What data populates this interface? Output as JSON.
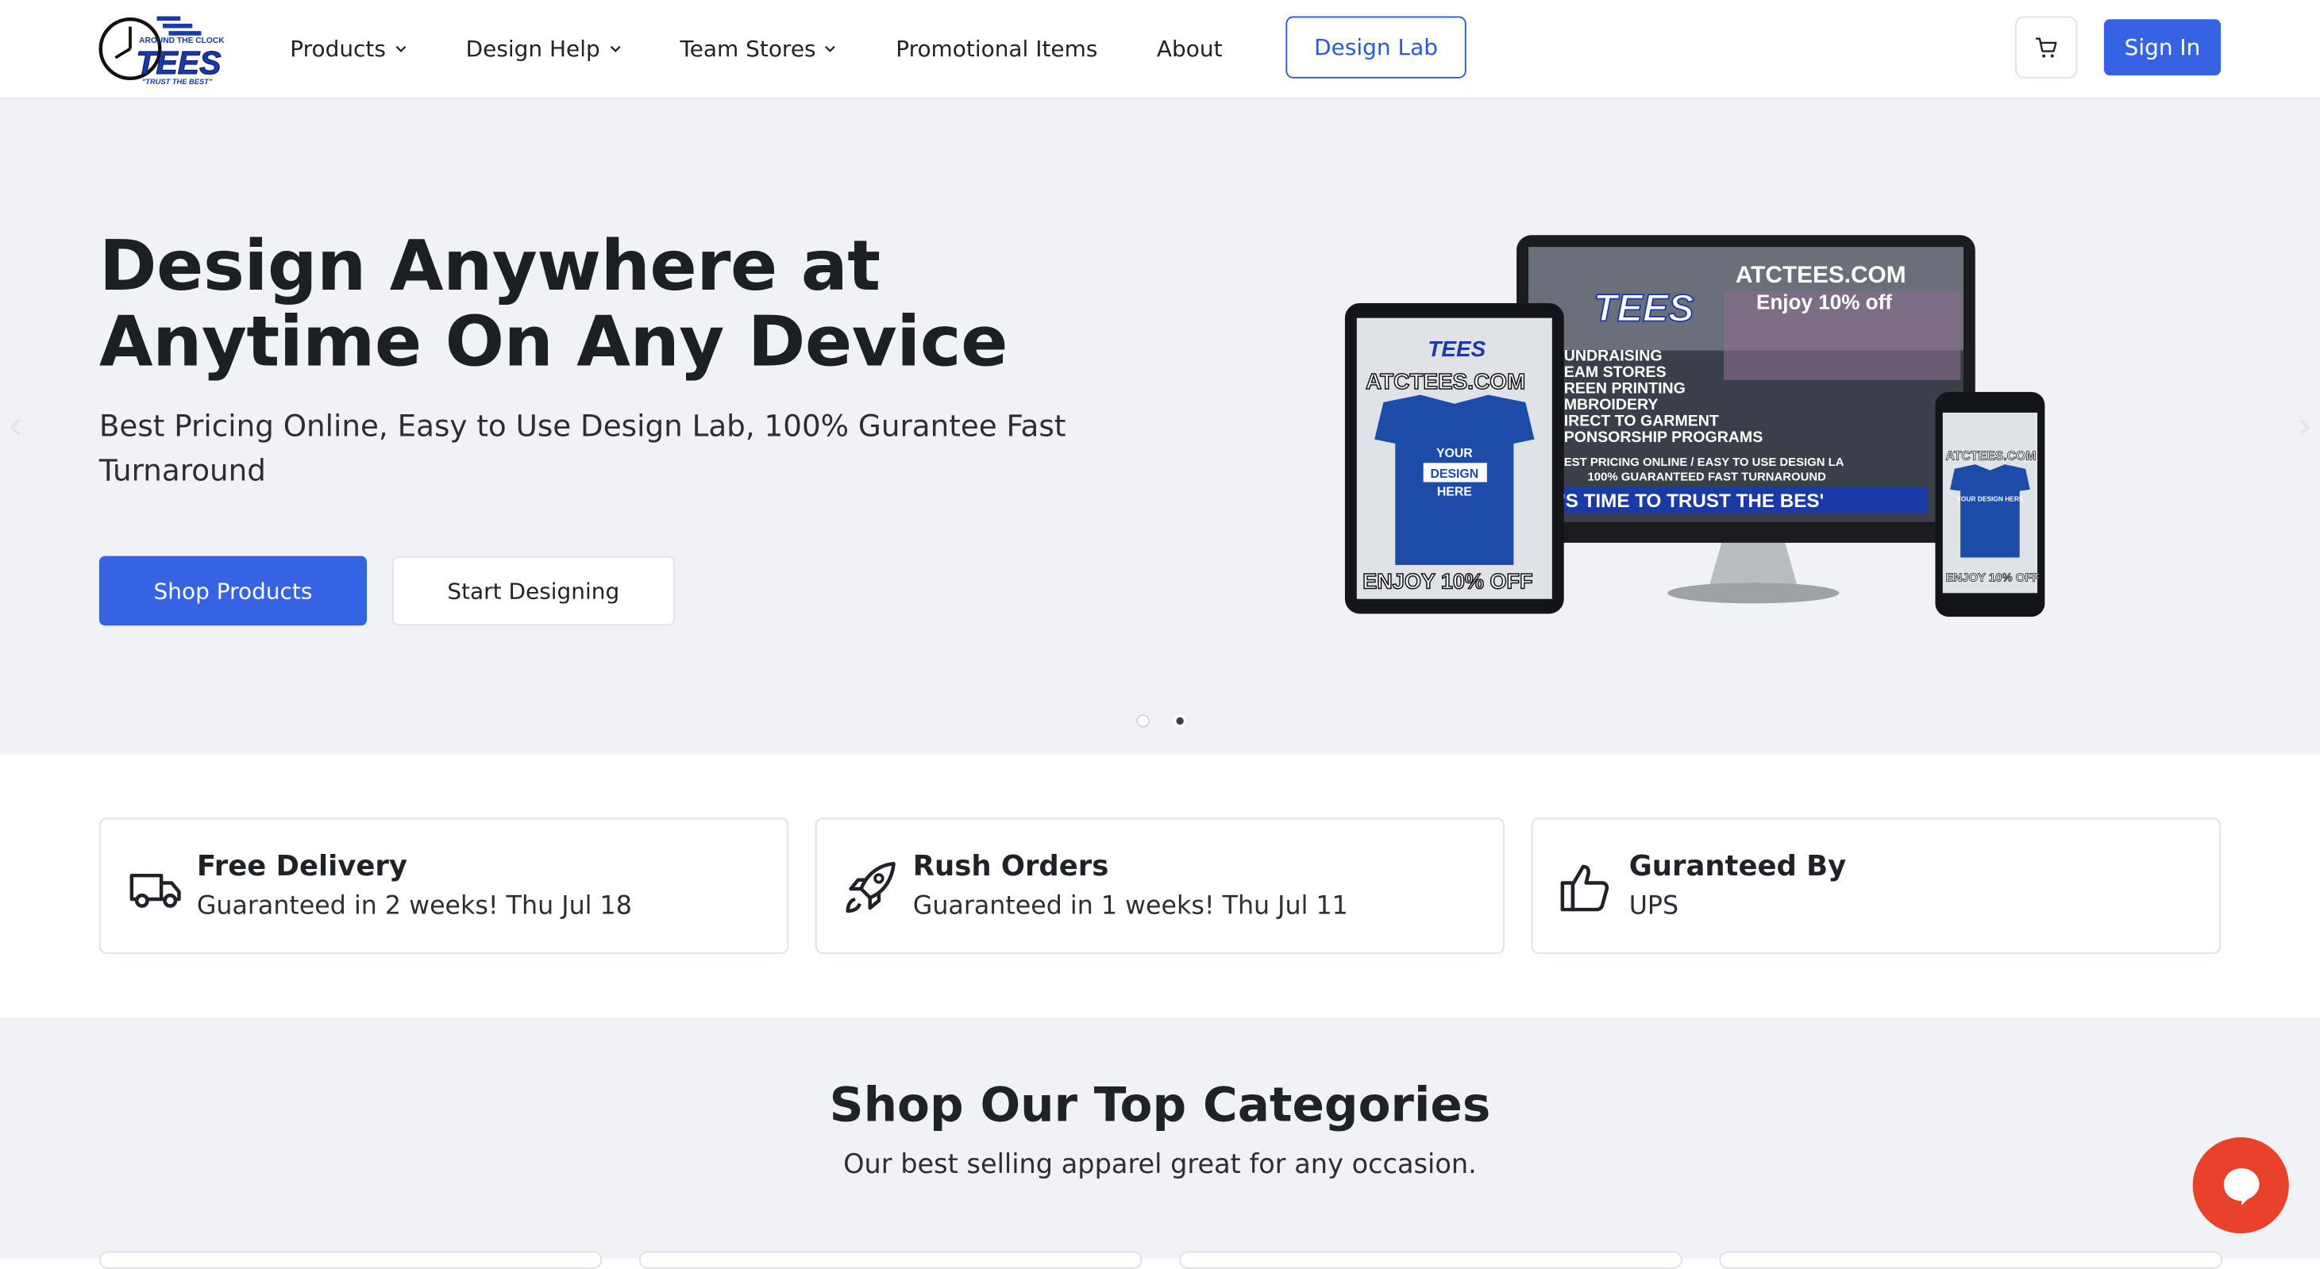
{
  "brand": {
    "logo_top": "AROUND THE CLOCK",
    "logo_main": "TEES",
    "logo_tagline": "\"TRUST THE BEST\""
  },
  "nav": {
    "items": [
      {
        "label": "Products",
        "dropdown": true
      },
      {
        "label": "Design Help",
        "dropdown": true
      },
      {
        "label": "Team Stores",
        "dropdown": true
      },
      {
        "label": "Promotional Items",
        "dropdown": false
      },
      {
        "label": "About",
        "dropdown": false
      }
    ],
    "design_lab_label": "Design Lab",
    "sign_in_label": "Sign In",
    "cart_icon": "cart-icon"
  },
  "hero": {
    "title": "Design Anywhere at Anytime On Any Device",
    "subtitle": "Best Pricing Online, Easy to Use Design Lab, 100% Gurantee Fast Turnaround",
    "primary_cta": "Shop Products",
    "secondary_cta": "Start Designing",
    "slide_count": 2,
    "active_slide": 2,
    "promo_image": {
      "site": "ATCTEES.COM",
      "offer": "Enjoy 10% off",
      "list": [
        "UNDRAISING",
        "EAM STORES",
        "REEN PRINTING",
        "MBROIDERY",
        "IRECT TO GARMENT",
        "PONSORSHIP PROGRAMS"
      ],
      "line1": "EST PRICING ONLINE / EASY TO USE DESIGN LA",
      "line2": "100% GUARANTEED FAST TURNAROUND",
      "banner": "'S TIME TO TRUST THE BES'",
      "tablet_site": "ATCTEES.COM",
      "tablet_shirt": "YOUR DESIGN HERE",
      "tablet_offer": "ENJOY 10% OFF",
      "phone_site": "ATCTEES.COM",
      "phone_shirt": "YOUR DESIGN HERE",
      "phone_offer": "ENJOY 10% OFF"
    }
  },
  "features": [
    {
      "icon": "truck-icon",
      "title": "Free Delivery",
      "subtitle": "Guaranteed in 2 weeks! Thu Jul 18"
    },
    {
      "icon": "rocket-icon",
      "title": "Rush Orders",
      "subtitle": "Guaranteed in 1 weeks! Thu Jul 11"
    },
    {
      "icon": "thumbs-up-icon",
      "title": "Guranteed By",
      "subtitle": "UPS"
    }
  ],
  "categories": {
    "title": "Shop Our Top Categories",
    "subtitle": "Our best selling apparel great for any occasion."
  },
  "colors": {
    "primary": "#3563e4",
    "hero_bg": "#f0f2f5",
    "chat": "#e8412c"
  }
}
